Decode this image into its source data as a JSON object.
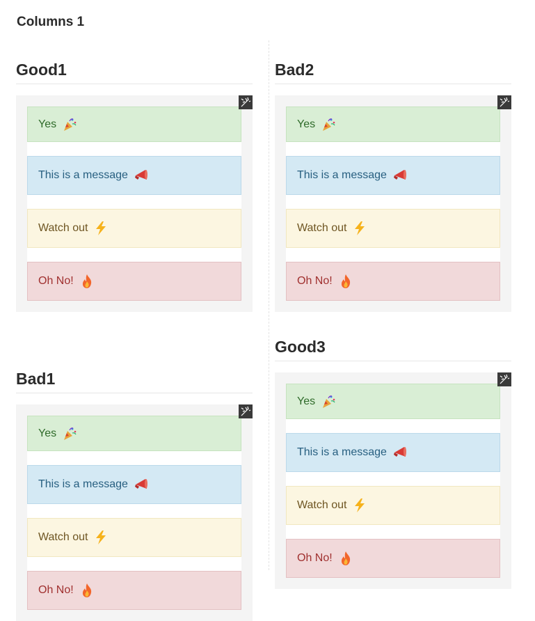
{
  "page": {
    "title": "Columns 1"
  },
  "sections": {
    "good1": {
      "title": "Good1"
    },
    "bad2": {
      "title": "Bad2"
    },
    "good3": {
      "title": "Good3"
    },
    "bad1": {
      "title": "Bad1"
    }
  },
  "alerts": {
    "success": {
      "text": "Yes",
      "icon": "party-popper-icon",
      "color": "#d9eed5"
    },
    "info": {
      "text": "This is a message",
      "icon": "megaphone-icon",
      "color": "#d4e9f4"
    },
    "warning": {
      "text": "Watch out",
      "icon": "lightning-icon",
      "color": "#fcf6e1"
    },
    "danger": {
      "text": "Oh No!",
      "icon": "fire-icon",
      "color": "#f1d9da"
    }
  }
}
